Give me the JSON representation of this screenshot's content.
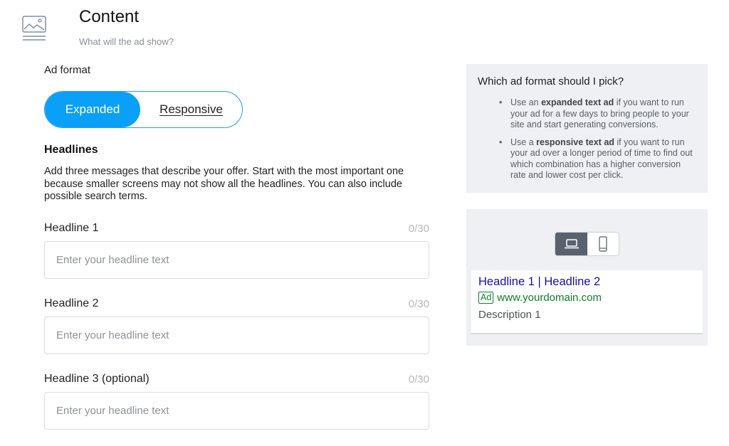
{
  "section": {
    "icon": "image-icon",
    "title": "Content",
    "subtitle": "What will the ad show?"
  },
  "ad_format": {
    "label": "Ad format",
    "options": [
      {
        "label": "Expanded",
        "selected": true
      },
      {
        "label": "Responsive",
        "selected": false
      }
    ]
  },
  "headlines": {
    "heading": "Headlines",
    "description": "Add three messages that describe your offer. Start with the most important one because smaller screens may not show all the headlines. You can also include possible search terms.",
    "fields": [
      {
        "label": "Headline 1",
        "count": "0/30",
        "value": "",
        "placeholder": "Enter your headline text"
      },
      {
        "label": "Headline 2",
        "count": "0/30",
        "value": "",
        "placeholder": "Enter your headline text"
      },
      {
        "label": "Headline 3 (optional)",
        "count": "0/30",
        "value": "",
        "placeholder": "Enter your headline text"
      }
    ]
  },
  "help": {
    "title": "Which ad format should I pick?",
    "items": [
      {
        "pre": "Use an ",
        "bold": "expanded text ad",
        "post": " if you want to run your ad for a few days to bring people to your site and start generating conversions."
      },
      {
        "pre": "Use a ",
        "bold": "responsive text ad",
        "post": " if you want to run your ad over a longer period of time to find out which combination has a higher conversion rate and lower cost per click."
      }
    ]
  },
  "preview": {
    "devices": [
      {
        "icon": "laptop-icon",
        "selected": true
      },
      {
        "icon": "mobile-icon",
        "selected": false
      }
    ],
    "ad": {
      "headline": "Headline 1 | Headline 2",
      "badge": "Ad",
      "url": "www.yourdomain.com",
      "description": "Description 1"
    }
  },
  "colors": {
    "accent": "#0aa0f7",
    "ad_link": "#1a0dab",
    "ad_url": "#0d7d2e",
    "panel_bg": "#eef0f3"
  }
}
